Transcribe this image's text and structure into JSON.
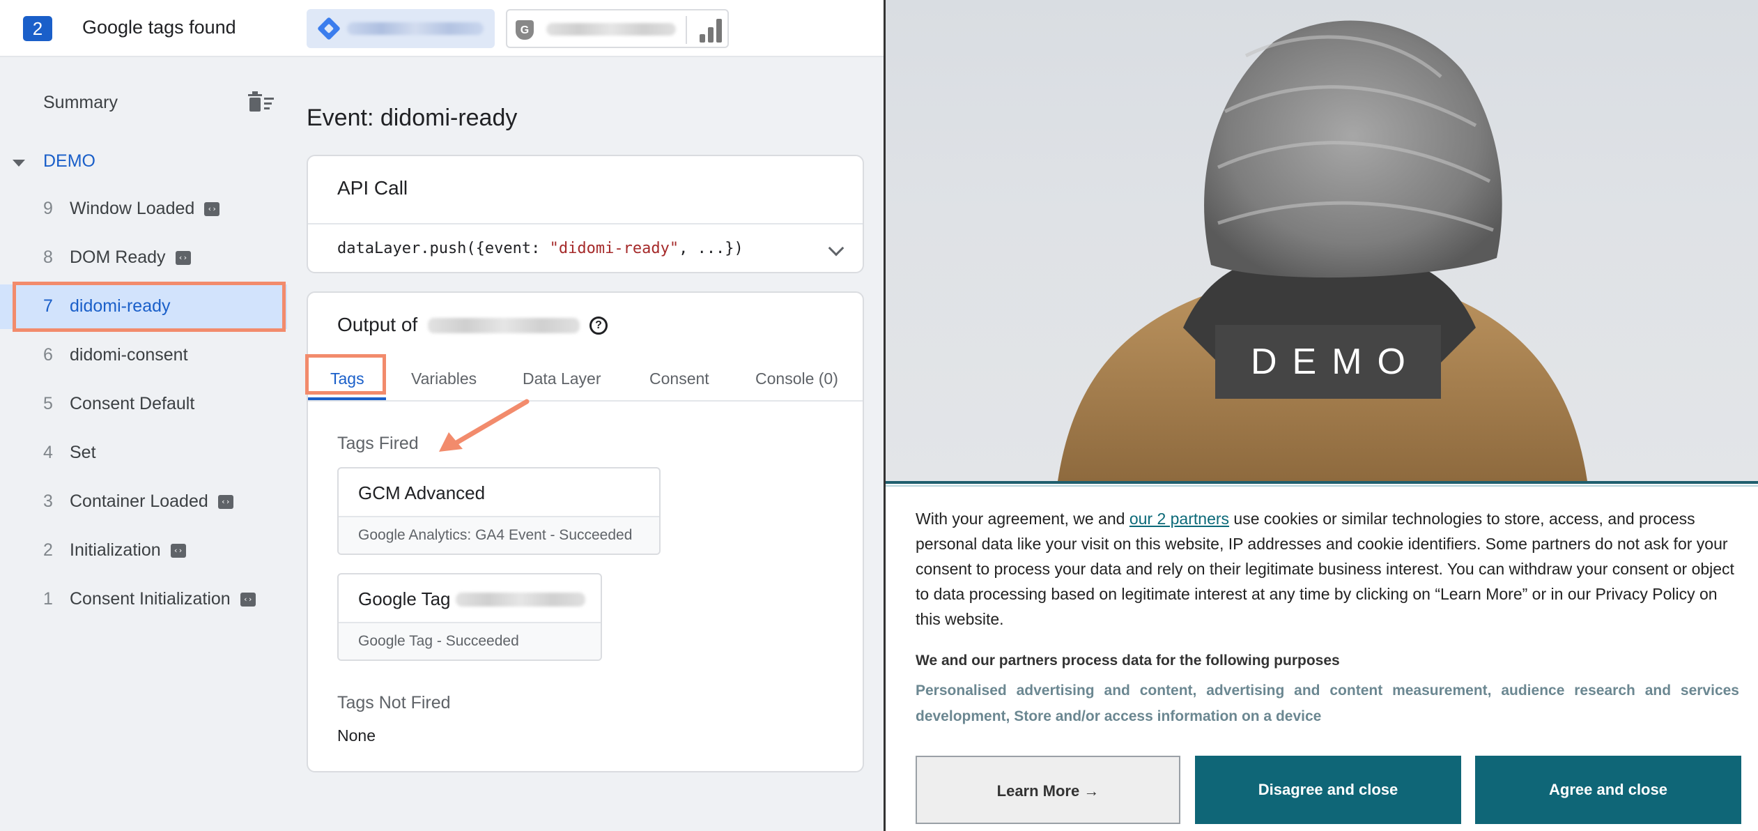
{
  "header": {
    "tag_count": "2",
    "title": "Google tags found"
  },
  "sidebar": {
    "summary_label": "Summary",
    "container_label": "DEMO",
    "events": [
      {
        "num": "9",
        "name": "Window Loaded",
        "code_icon": true
      },
      {
        "num": "8",
        "name": "DOM Ready",
        "code_icon": true
      },
      {
        "num": "7",
        "name": "didomi-ready",
        "code_icon": false,
        "selected": true
      },
      {
        "num": "6",
        "name": "didomi-consent",
        "code_icon": false
      },
      {
        "num": "5",
        "name": "Consent Default",
        "code_icon": false
      },
      {
        "num": "4",
        "name": "Set",
        "code_icon": false
      },
      {
        "num": "3",
        "name": "Container Loaded",
        "code_icon": true
      },
      {
        "num": "2",
        "name": "Initialization",
        "code_icon": true
      },
      {
        "num": "1",
        "name": "Consent Initialization",
        "code_icon": true
      }
    ]
  },
  "main": {
    "event_title": "Event: didomi-ready",
    "api_card": {
      "header": "API Call",
      "code_prefix": "dataLayer.push({event: ",
      "code_string": "\"didomi-ready\"",
      "code_suffix": ", ...})"
    },
    "output": {
      "label": "Output of",
      "tabs": [
        "Tags",
        "Variables",
        "Data Layer",
        "Consent",
        "Console (0)"
      ],
      "active_tab": "Tags",
      "tags_fired_label": "Tags Fired",
      "tags_fired": [
        {
          "name": "GCM Advanced",
          "detail": "Google Analytics: GA4 Event - Succeeded"
        },
        {
          "name": "Google Tag",
          "detail": "Google Tag - Succeeded"
        }
      ],
      "tags_not_fired_label": "Tags Not Fired",
      "tags_not_fired_value": "None"
    }
  },
  "site": {
    "hero_badge": "DEMO",
    "consent_text_before_link": "With your agreement, we and ",
    "consent_link": "our 2 partners",
    "consent_text_after_link": " use cookies or similar technologies to store, access, and process personal data like your visit on this website, IP addresses and cookie identifiers. Some partners do not ask for your consent to process your data and rely on their legitimate business interest. You can withdraw your consent or object to data processing based on legitimate interest at any time by clicking on “Learn More” or in our Privacy Policy on this website.",
    "purposes_heading": "We and our partners process data for the following purposes",
    "purposes_list": "Personalised advertising and content, advertising and content measurement, audience research and services development, Store and/or access information on a device",
    "buttons": {
      "learn_more": "Learn More →",
      "disagree": "Disagree and close",
      "agree": "Agree and close"
    }
  },
  "colors": {
    "accent_blue": "#1a5fc9",
    "highlight_orange": "#f28b6c",
    "consent_teal": "#0f6677"
  }
}
